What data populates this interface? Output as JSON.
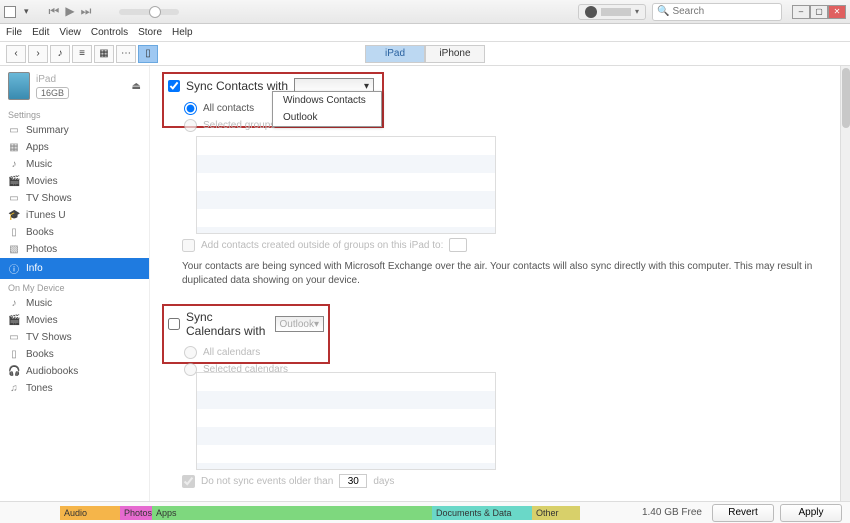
{
  "menubar": [
    "File",
    "Edit",
    "View",
    "Controls",
    "Store",
    "Help"
  ],
  "search": {
    "placeholder": "Search"
  },
  "device_tabs": {
    "active": "iPad",
    "inactive": "iPhone"
  },
  "device": {
    "name": "iPad",
    "storage": "16GB"
  },
  "sidebar": {
    "settings_header": "Settings",
    "settings": [
      {
        "icon": "▭",
        "label": "Summary"
      },
      {
        "icon": "▦",
        "label": "Apps"
      },
      {
        "icon": "♪",
        "label": "Music"
      },
      {
        "icon": "🎬",
        "label": "Movies"
      },
      {
        "icon": "▭",
        "label": "TV Shows"
      },
      {
        "icon": "🎓",
        "label": "iTunes U"
      },
      {
        "icon": "▯",
        "label": "Books"
      },
      {
        "icon": "▧",
        "label": "Photos"
      },
      {
        "icon": "ⓘ",
        "label": "Info"
      }
    ],
    "device_header": "On My Device",
    "on_device": [
      {
        "icon": "♪",
        "label": "Music"
      },
      {
        "icon": "🎬",
        "label": "Movies"
      },
      {
        "icon": "▭",
        "label": "TV Shows"
      },
      {
        "icon": "▯",
        "label": "Books"
      },
      {
        "icon": "🎧",
        "label": "Audiobooks"
      },
      {
        "icon": "♫",
        "label": "Tones"
      }
    ]
  },
  "contacts": {
    "title": "Sync Contacts with",
    "dropdown_options": [
      "Windows Contacts",
      "Outlook"
    ],
    "radio_all": "All contacts",
    "radio_selected": "Selected groups",
    "add_option": "Add contacts created outside of groups on this iPad to:",
    "note": "Your contacts are being synced with Microsoft Exchange over the air. Your contacts will also sync directly with this computer. This may result in duplicated data showing on your device."
  },
  "calendars": {
    "title": "Sync Calendars with",
    "dropdown_value": "Outlook",
    "radio_all": "All calendars",
    "radio_selected": "Selected calendars",
    "older_label_prefix": "Do not sync events older than",
    "older_value": "30",
    "older_label_suffix": "days"
  },
  "storage_bar": {
    "segments": [
      {
        "label": "Audio"
      },
      {
        "label": "Photos"
      },
      {
        "label": "Apps"
      },
      {
        "label": "Documents & Data"
      },
      {
        "label": "Other"
      }
    ],
    "free": "1.40 GB Free"
  },
  "buttons": {
    "revert": "Revert",
    "apply": "Apply"
  }
}
